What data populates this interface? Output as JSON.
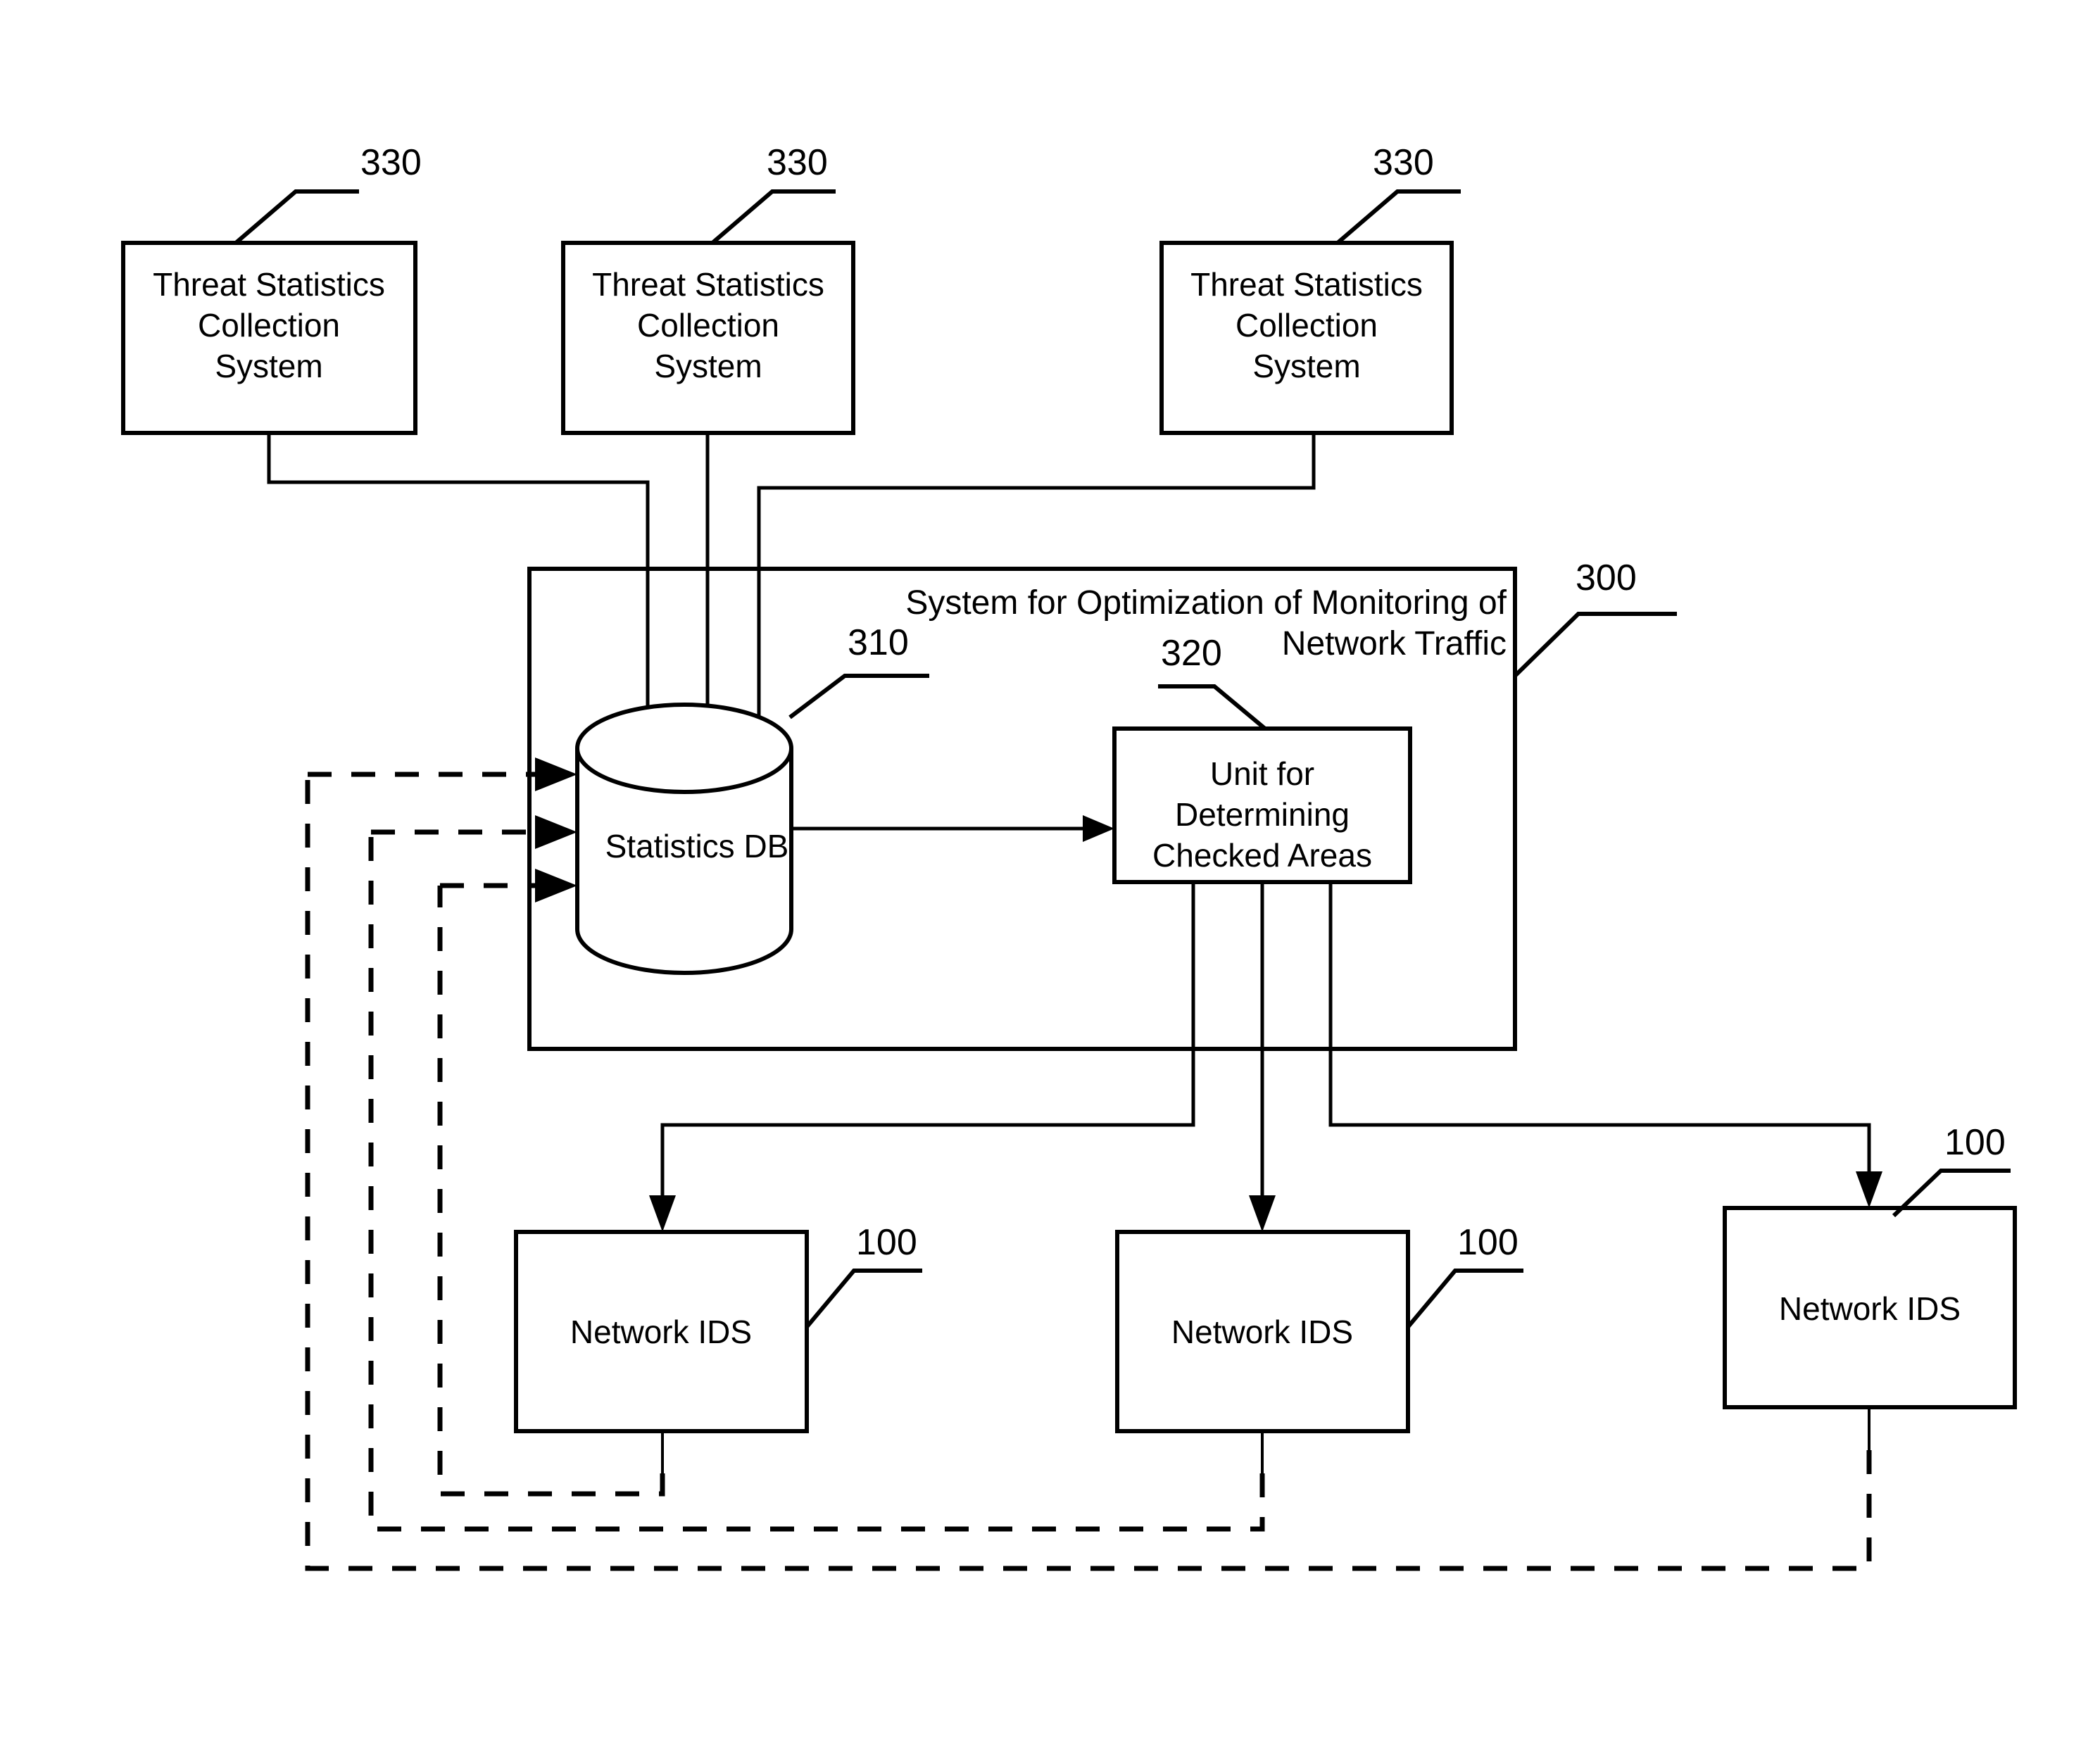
{
  "figure": {
    "title": "System for Optimization of Monitoring of Network Traffic",
    "background_color": "#ffffff",
    "line_color": "#000000"
  },
  "collectors": {
    "label_line1": "Threat Statistics",
    "label_line2": "Collection",
    "label_line3": "System",
    "ref": "330",
    "items": [
      {
        "ref": "330",
        "label": "Threat Statistics Collection System"
      },
      {
        "ref": "330",
        "label": "Threat Statistics Collection System"
      },
      {
        "ref": "330",
        "label": "Threat Statistics Collection System"
      }
    ]
  },
  "system": {
    "ref": "300",
    "title_line1": "System for Optimization of Monitoring of",
    "title_line2": "Network Traffic",
    "database": {
      "ref": "310",
      "label": "Statistics DB"
    },
    "unit": {
      "ref": "320",
      "label_line1": "Unit for",
      "label_line2": "Determining",
      "label_line3": "Checked Areas"
    }
  },
  "sensors": {
    "label": "Network IDS",
    "ref": "100",
    "items": [
      {
        "ref": "100",
        "label": "Network IDS"
      },
      {
        "ref": "100",
        "label": "Network IDS"
      },
      {
        "ref": "100",
        "label": "Network IDS"
      }
    ]
  }
}
